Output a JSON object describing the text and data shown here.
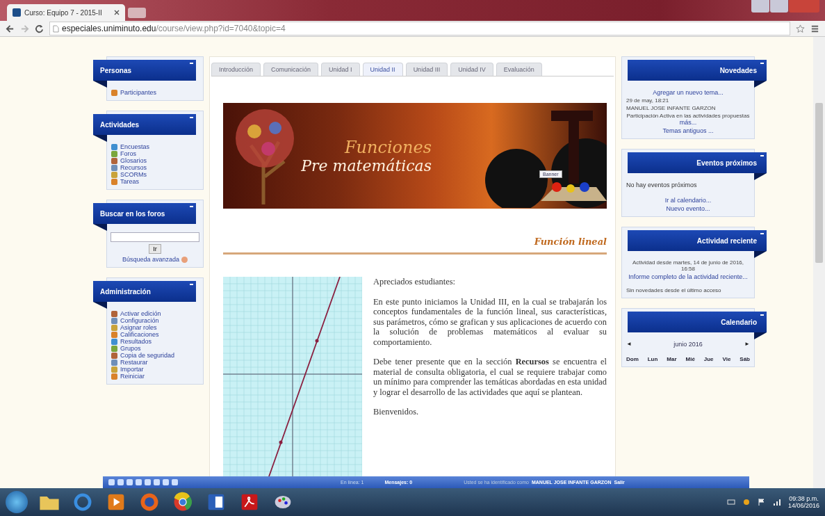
{
  "browser": {
    "tab_title": "Curso: Equipo 7 - 2015-II",
    "url_host": "especiales.uniminuto.edu",
    "url_path": "/course/view.php?id=7040&topic=4"
  },
  "left_blocks": [
    {
      "kind": "list",
      "title": "Personas",
      "items": [
        "Participantes"
      ]
    },
    {
      "kind": "list",
      "title": "Actividades",
      "items": [
        "Encuestas",
        "Foros",
        "Glosarios",
        "Recursos",
        "SCORMs",
        "Tareas"
      ]
    },
    {
      "kind": "search",
      "title": "Buscar en los foros",
      "button": "Ir",
      "link": "Búsqueda avanzada"
    },
    {
      "kind": "list",
      "title": "Administración",
      "items": [
        "Activar edición",
        "Configuración",
        "Asignar roles",
        "Calificaciones",
        "Resultados",
        "Grupos",
        "Copia de seguridad",
        "Restaurar",
        "Importar",
        "Reiniciar"
      ]
    }
  ],
  "tabs": [
    {
      "label": "Introducción",
      "selected": false
    },
    {
      "label": "Comunicación",
      "selected": false
    },
    {
      "label": "Unidad I",
      "selected": false
    },
    {
      "label": "Unidad II",
      "selected": true
    },
    {
      "label": "Unidad III",
      "selected": false
    },
    {
      "label": "Unidad IV",
      "selected": false
    },
    {
      "label": "Evaluación",
      "selected": false
    }
  ],
  "banner": {
    "title": "Funciones",
    "subtitle": "Pre matemáticas",
    "button": "Banner"
  },
  "section_heading": "Función lineal",
  "paragraphs": [
    "Apreciados estudiantes:",
    "En este punto iniciamos la Unidad III, en la cual se trabajarán los conceptos fundamentales de la función lineal, sus características, sus parámetros, cómo se grafican y sus aplicaciones de acuerdo con la solución de problemas matemáticos al evaluar su comportamiento.",
    "Debe tener presente que en la sección **Recursos** se encuentra el material de consulta obligatoria, el cual se requiere trabajar como un mínimo para comprender las temáticas abordadas en esta unidad y lograr el desarrollo de las actividades que aquí se plantean.",
    "Bienvenidos."
  ],
  "right_blocks": [
    {
      "kind": "news",
      "title": "Novedades",
      "add_link": "Agregar un nuevo tema...",
      "date": "29 de may, 18:21",
      "author": "MANUEL JOSE INFANTE GARZON",
      "text": "Participación Activa en las actividades propuestas",
      "more": "más...",
      "old_link": "Temas antiguos ..."
    },
    {
      "kind": "events",
      "title": "Eventos próximos",
      "text": "No hay eventos próximos",
      "links": [
        "Ir al calendario...",
        "Nuevo evento..."
      ]
    },
    {
      "kind": "recent",
      "title": "Actividad reciente",
      "since": "Actividad desde martes, 14 de junio de 2016, 16:58",
      "link": "Informe completo de la actividad reciente...",
      "text": "Sin novedades desde el último acceso"
    },
    {
      "kind": "calendar",
      "title": "Calendario",
      "prev": "◄",
      "month": "junio 2016",
      "next": "►",
      "days": [
        "Dom",
        "Lun",
        "Mar",
        "Mié",
        "Jue",
        "Vie",
        "Sáb"
      ]
    }
  ],
  "dock": {
    "online": "En línea: 1",
    "messages": "Mensajes: 0",
    "login_text": "Usted se ha identificado como",
    "user": "MANUEL JOSE INFANTE GARZON",
    "logout": "Salir"
  },
  "taskbar": {
    "time": "09:38 p.m.",
    "date": "14/06/2016"
  }
}
